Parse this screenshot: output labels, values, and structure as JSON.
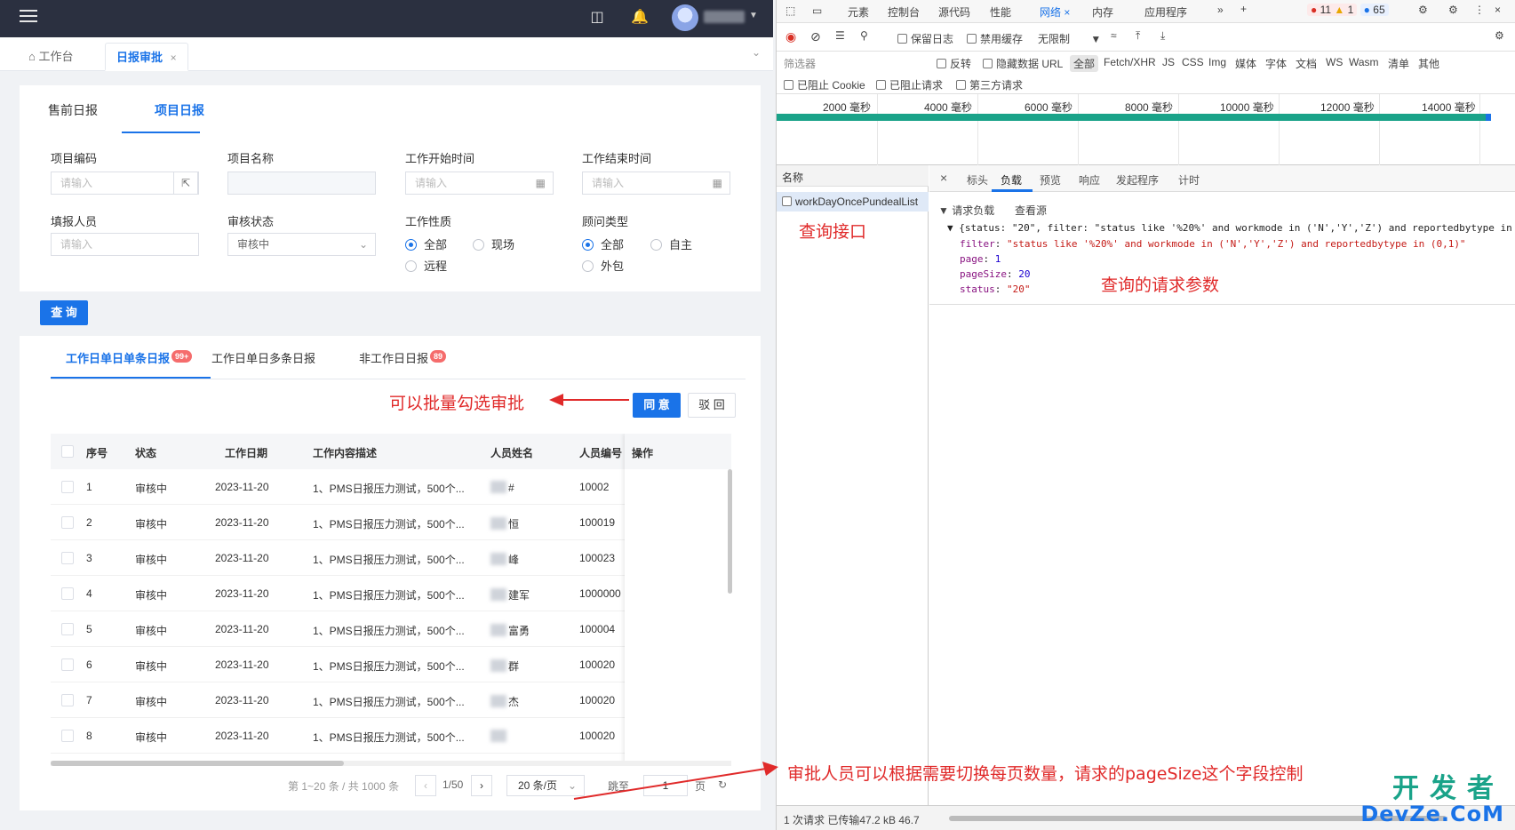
{
  "app": {
    "tabs": {
      "home": "工作台",
      "active": "日报审批",
      "close": "×"
    },
    "subtabs": [
      "售前日报",
      "项目日报"
    ],
    "filters": {
      "project_code": "项目编码",
      "project_name": "项目名称",
      "start_time": "工作开始时间",
      "end_time": "工作结束时间",
      "reporter": "填报人员",
      "audit_status": "审核状态",
      "work_nature": "工作性质",
      "consultant_type": "顾问类型",
      "placeholder": "请输入",
      "audit_status_value": "审核中",
      "work_nature_options": [
        "全部",
        "现场",
        "远程"
      ],
      "consultant_options": [
        "全部",
        "自主",
        "外包"
      ]
    },
    "query_button": "查 询",
    "list_tabs": [
      {
        "label": "工作日单日单条日报",
        "badge": "99+"
      },
      {
        "label": "工作日单日多条日报",
        "badge": ""
      },
      {
        "label": "非工作日日报",
        "badge": "89"
      }
    ],
    "agree_button": "同 意",
    "reject_button": "驳 回",
    "table": {
      "headers": [
        "序号",
        "状态",
        "工作日期",
        "工作内容描述",
        "人员姓名",
        "人员编号",
        "操作"
      ],
      "rows": [
        {
          "no": "1",
          "status": "审核中",
          "date": "2023-11-20",
          "desc": "1、PMS日报压力测试，500个...",
          "name": "#",
          "id": "10002"
        },
        {
          "no": "2",
          "status": "审核中",
          "date": "2023-11-20",
          "desc": "1、PMS日报压力测试，500个...",
          "name": "恒",
          "id": "100019"
        },
        {
          "no": "3",
          "status": "审核中",
          "date": "2023-11-20",
          "desc": "1、PMS日报压力测试，500个...",
          "name": "峰",
          "id": "100023"
        },
        {
          "no": "4",
          "status": "审核中",
          "date": "2023-11-20",
          "desc": "1、PMS日报压力测试，500个...",
          "name": "建军",
          "id": "1000000"
        },
        {
          "no": "5",
          "status": "审核中",
          "date": "2023-11-20",
          "desc": "1、PMS日报压力测试，500个...",
          "name": "富勇",
          "id": "100004"
        },
        {
          "no": "6",
          "status": "审核中",
          "date": "2023-11-20",
          "desc": "1、PMS日报压力测试，500个...",
          "name": "群",
          "id": "100020"
        },
        {
          "no": "7",
          "status": "审核中",
          "date": "2023-11-20",
          "desc": "1、PMS日报压力测试，500个...",
          "name": "杰",
          "id": "100020"
        },
        {
          "no": "8",
          "status": "审核中",
          "date": "2023-11-20",
          "desc": "1、PMS日报压力测试，500个...",
          "name": "",
          "id": "100020"
        }
      ]
    },
    "pagination": {
      "summary": "第 1~20 条 / 共 1000 条",
      "page": "1/50",
      "page_size": "20 条/页",
      "goto": "跳至",
      "goto_value": "1",
      "page_unit": "页"
    }
  },
  "devtools": {
    "tabs": [
      "元素",
      "控制台",
      "源代码",
      "性能",
      "网络",
      "内存",
      "应用程序"
    ],
    "errors": "11",
    "warnings": "1",
    "info": "65",
    "toolbar": {
      "preserve_log": "保留日志",
      "disable_cache": "禁用缓存",
      "throttle": "无限制"
    },
    "filter": {
      "label": "筛选器",
      "invert": "反转",
      "hide_data_urls": "隐藏数据 URL",
      "types": [
        "全部",
        "Fetch/XHR",
        "JS",
        "CSS",
        "Img",
        "媒体",
        "字体",
        "文档",
        "WS",
        "Wasm",
        "清单",
        "其他"
      ],
      "blocked_cookies": "已阻止 Cookie",
      "blocked_requests": "已阻止请求",
      "third_party": "第三方请求"
    },
    "timeline": [
      "2000 毫秒",
      "4000 毫秒",
      "6000 毫秒",
      "8000 毫秒",
      "10000 毫秒",
      "12000 毫秒",
      "14000 毫秒"
    ],
    "names_header": "名称",
    "request_name": "workDayOncePundealList",
    "detail_tabs": [
      "标头",
      "负载",
      "预览",
      "响应",
      "发起程序",
      "计时"
    ],
    "payload_title": "请求负载",
    "view_source": "查看源",
    "payload": {
      "summary": "{status: \"20\", filter: \"status like '%20%' and workmode in ('N','Y','Z') and reportedbytype in",
      "filter_key": "filter",
      "filter_val": "\"status like '%20%' and workmode in ('N','Y','Z') and reportedbytype in (0,1)\"",
      "page_key": "page",
      "page_val": "1",
      "pagesize_key": "pageSize",
      "pagesize_val": "20",
      "status_key": "status",
      "status_val": "\"20\""
    },
    "status_bar": "1 次请求  已传输47.2 kB  46.7"
  },
  "annotations": {
    "query_api": "查询接口",
    "query_params": "查询的请求参数",
    "batch_approve": "可以批量勾选审批",
    "page_size_note": "审批人员可以根据需要切换每页数量，请求的pageSize这个字段控制"
  },
  "watermark": {
    "line1": "开发者",
    "line2": "DevZe.CoM"
  }
}
